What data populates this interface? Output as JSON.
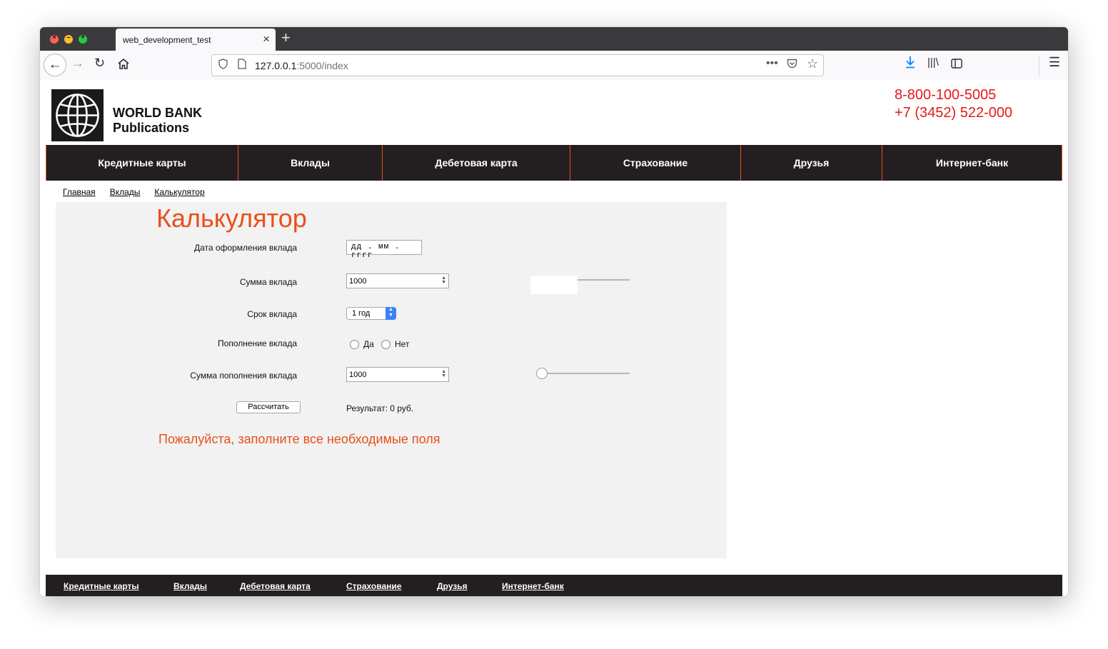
{
  "browser": {
    "tab_title": "web_development_test",
    "url_host": "127.0.0.1",
    "url_path": ":5000/index"
  },
  "header": {
    "brand_line1": "WORLD BANK",
    "brand_line2": "Publications",
    "phone1": "8-800-100-5005",
    "phone2": "+7 (3452) 522-000"
  },
  "menu": [
    "Кредитные карты",
    "Вклады",
    "Дебетовая карта",
    "Страхование",
    "Друзья",
    "Интернет-банк"
  ],
  "breadcrumb": [
    "Главная",
    "Вклады",
    "Калькулятор"
  ],
  "calculator": {
    "title": "Калькулятор",
    "date_label": "Дата оформления вклада",
    "date_placeholder": "дд . мм . гггг",
    "amount_label": "Сумма вклада",
    "amount_value": "1000",
    "term_label": "Срок вклада",
    "term_value": "1 год",
    "topup_label": "Пополнение вклада",
    "topup_yes": "Да",
    "topup_no": "Нет",
    "topup_amount_label": "Сумма пополнения вклада",
    "topup_amount_value": "1000",
    "topup_slider_level": 0,
    "button": "Рассчитать",
    "result": "Результат: 0 руб.",
    "warning": "Пожалуйста, заполните все необходимые поля"
  },
  "footer": [
    "Кредитные карты",
    "Вклады",
    "Дебетовая карта",
    "Страхование",
    "Друзья",
    "Интернет-банк"
  ],
  "colors": {
    "accent": "#e8501a",
    "phone": "#e41a1a",
    "menu_bg": "#231f20",
    "panel_bg": "#f2f2f2"
  }
}
